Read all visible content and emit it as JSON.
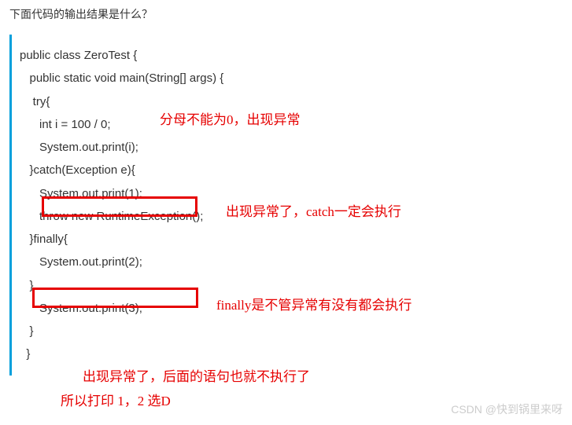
{
  "question": "下面代码的输出结果是什么？",
  "code": {
    "l1": "public class ZeroTest {",
    "l2": "   public static void main(String[] args) {",
    "l3": "    try{",
    "l4": "      int i = 100 / 0;",
    "l5": "      System.out.print(i);",
    "l6": "   }catch(Exception e){",
    "l7": "      System.out.print(1);",
    "l8": "      throw new RuntimeException();",
    "l9": "   }finally{",
    "l10": "      System.out.print(2);",
    "l11": "   }",
    "l12": "      System.out.print(3);",
    "l13": "   }",
    "l14": "  }"
  },
  "annotations": {
    "a1": "分母不能为0，出现异常",
    "a2": "出现异常了，catch一定会执行",
    "a3": "finally是不管异常有没有都会执行",
    "a4": "出现异常了，后面的语句也就不执行了",
    "a5": "所以打印 1，2 选D"
  },
  "watermark": "CSDN @快到锅里来呀"
}
